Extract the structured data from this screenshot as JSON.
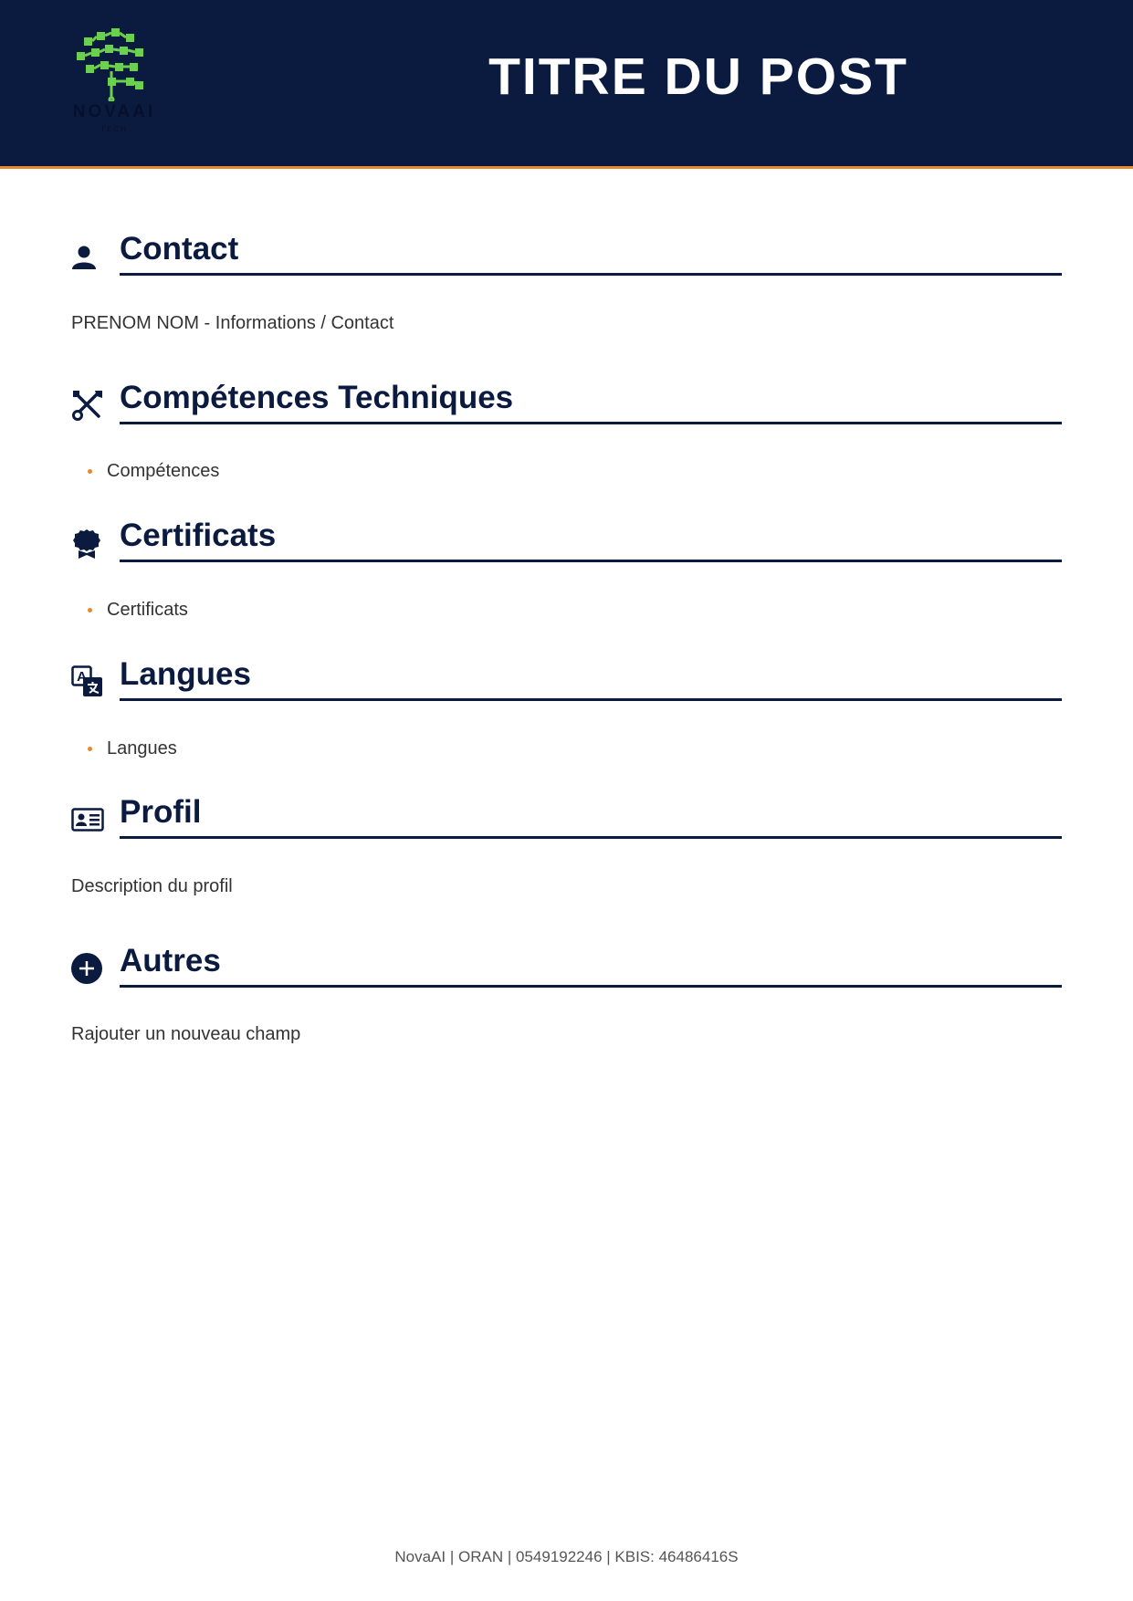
{
  "header": {
    "logo_name": "NOVAAI",
    "logo_sub": "TECH",
    "title": "TITRE DU POST"
  },
  "sections": {
    "contact": {
      "icon": "person-icon",
      "title": "Contact",
      "text": "PRENOM NOM - Informations / Contact"
    },
    "skills": {
      "icon": "tools-icon",
      "title": "Compétences Techniques",
      "items": [
        "Compétences"
      ]
    },
    "certificates": {
      "icon": "award-icon",
      "title": "Certificats",
      "items": [
        "Certificats"
      ]
    },
    "languages": {
      "icon": "translate-icon",
      "title": "Langues",
      "items": [
        "Langues"
      ]
    },
    "profile": {
      "icon": "id-card-icon",
      "title": "Profil",
      "text": "Description du profil"
    },
    "others": {
      "icon": "plus-circle-icon",
      "title": "Autres",
      "text": "Rajouter un nouveau champ"
    }
  },
  "footer": {
    "text": "NovaAI | ORAN | 0549192246 | KBIS: 46486416S"
  },
  "colors": {
    "header_bg": "#0b1a3f",
    "accent": "#e8892f",
    "title_color": "#0b1a3f",
    "logo_green": "#6bd04f"
  }
}
